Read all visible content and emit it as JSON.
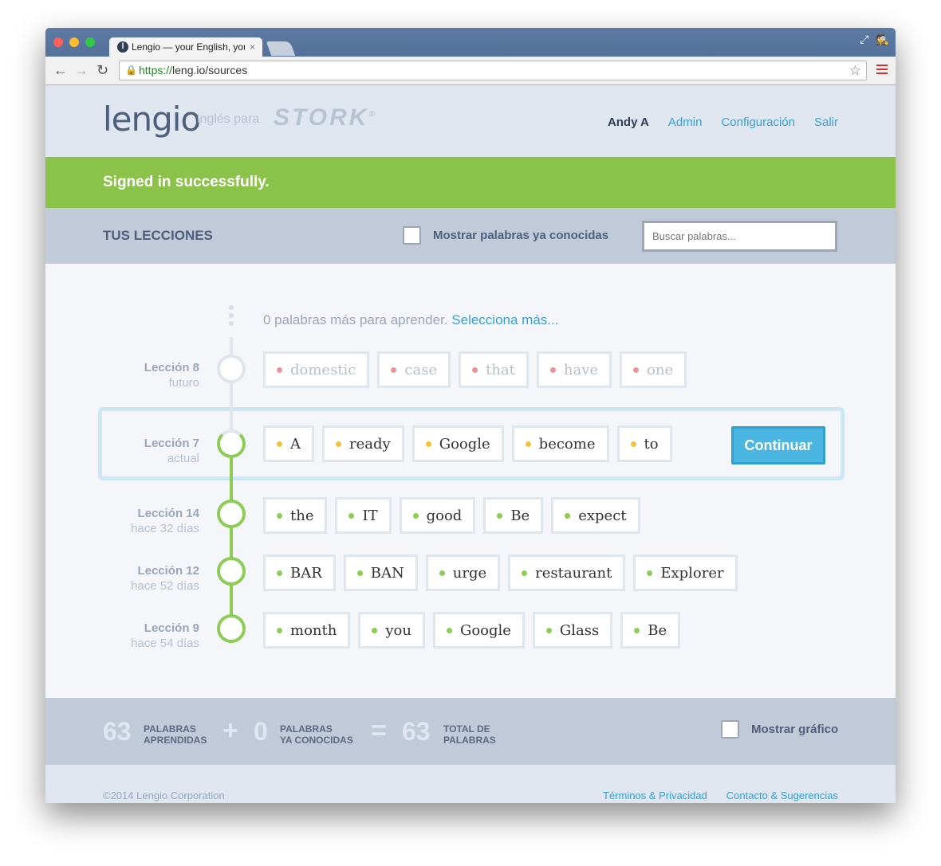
{
  "browser": {
    "tab_title": "Lengio — your English, you",
    "url_scheme": "https://",
    "url_rest": "leng.io/sources"
  },
  "header": {
    "logo": "lengio",
    "tagline": "inglés para",
    "partner": "STORK",
    "nav": {
      "user": "Andy A",
      "admin": "Admin",
      "settings": "Configuración",
      "logout": "Salir"
    }
  },
  "flash": "Signed in successfully.",
  "filter": {
    "title": "TUS LECCIONES",
    "show_known_label": "Mostrar palabras ya conocidas",
    "search_placeholder": "Buscar palabras..."
  },
  "timeline": {
    "more_text": "0 palabras más para aprender.",
    "more_link": "Selecciona más...",
    "continue_label": "Continuar",
    "lessons": [
      {
        "name": "Lección 8",
        "sub": "futuro",
        "state": "future",
        "dot_color": "#f0909a",
        "words": [
          "domestic",
          "case",
          "that",
          "have",
          "one"
        ]
      },
      {
        "name": "Lección 7",
        "sub": "actual",
        "state": "current",
        "dot_color": "#f5c33b",
        "words": [
          "A",
          "ready",
          "Google",
          "become",
          "to"
        ]
      },
      {
        "name": "Lección 14",
        "sub": "hace 32 días",
        "state": "done",
        "dot_color": "#8dcd55",
        "words": [
          "the",
          "IT",
          "good",
          "Be",
          "expect"
        ]
      },
      {
        "name": "Lección 12",
        "sub": "hace 52 días",
        "state": "done",
        "dot_color": "#8dcd55",
        "words": [
          "BAR",
          "BAN",
          "urge",
          "restaurant",
          "Explorer"
        ]
      },
      {
        "name": "Lección 9",
        "sub": "hace 54 días",
        "state": "done",
        "dot_color": "#8dcd55",
        "words": [
          "month",
          "you",
          "Google",
          "Glass",
          "Be"
        ]
      }
    ]
  },
  "stats": {
    "learned_num": "63",
    "learned_label_1": "PALABRAS",
    "learned_label_2": "APRENDIDAS",
    "plus": "+",
    "known_num": "0",
    "known_label_1": "PALABRAS",
    "known_label_2": "YA CONOCIDAS",
    "equals": "=",
    "total_num": "63",
    "total_label_1": "TOTAL DE",
    "total_label_2": "PALABRAS",
    "show_chart_label": "Mostrar gráfico"
  },
  "footer": {
    "copyright": "©2014 Lengio Corporation",
    "terms": "Términos & Privacidad",
    "contact": "Contacto & Sugerencias"
  }
}
